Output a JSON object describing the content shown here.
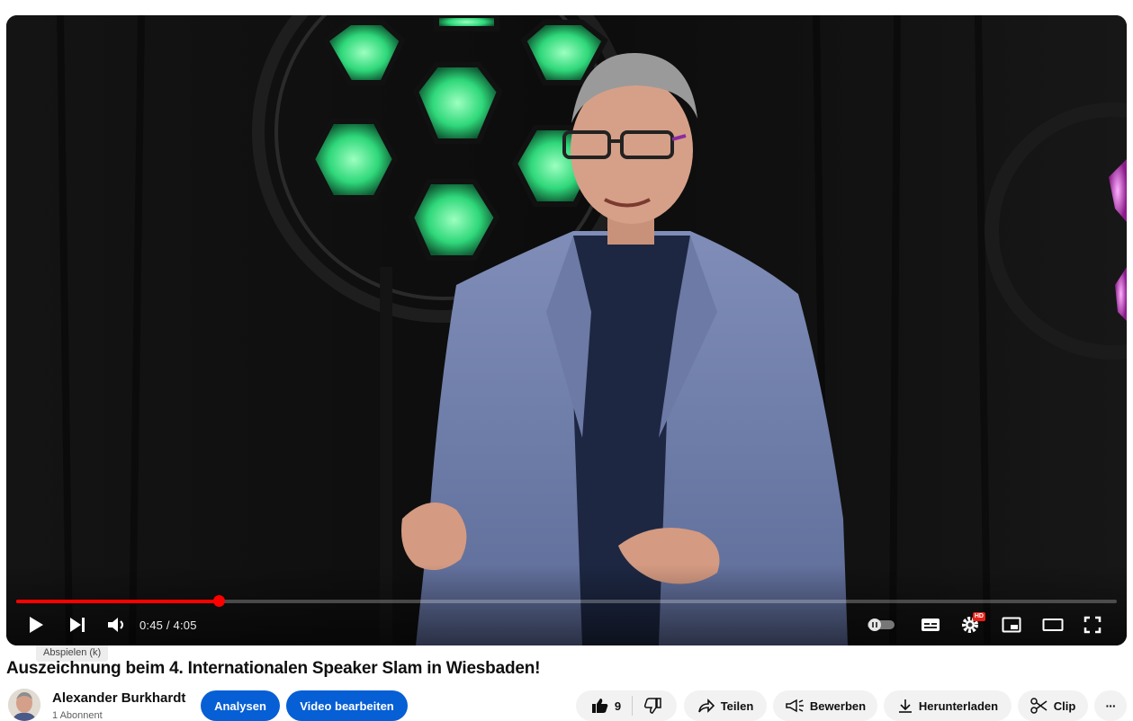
{
  "player": {
    "progress": 0.184,
    "time_current": "0:45",
    "time_total": "4:05",
    "time_separator": " / ",
    "tooltip": "Abspielen (k)",
    "hd_badge": "HD",
    "colors": {
      "progress": "#ff0000",
      "background": "#0a0a0a"
    }
  },
  "video": {
    "title": "Auszeichnung beim 4. Internationalen Speaker Slam in Wiesbaden!"
  },
  "channel": {
    "name": "Alexander Burkhardt",
    "subscribers": "1 Abonnent"
  },
  "actions": {
    "analytics": "Analysen",
    "edit_video": "Video bearbeiten",
    "like_count": "9",
    "share": "Teilen",
    "promote": "Bewerben",
    "download": "Herunterladen",
    "clip": "Clip",
    "more": "···",
    "accent": "#065fd4"
  }
}
